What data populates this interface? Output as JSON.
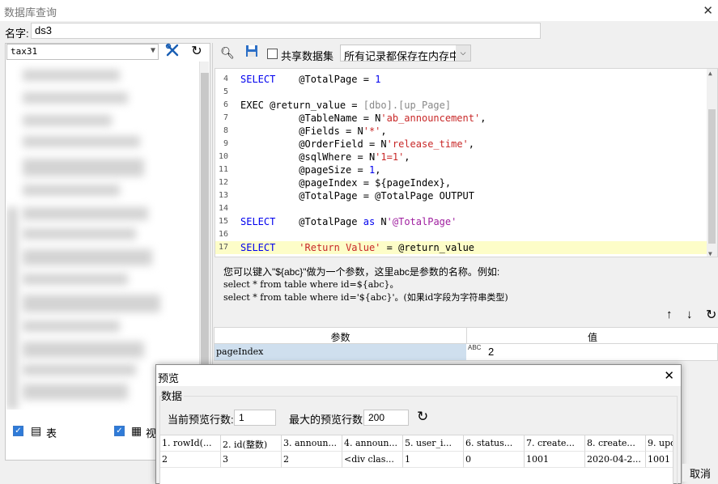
{
  "window": {
    "title": "数据库查询"
  },
  "name_field": {
    "label": "名字:",
    "value": "ds3"
  },
  "left": {
    "datasource": "tax31",
    "checkbox_table_label": "表",
    "checkbox_view_label": "视"
  },
  "toolbar": {
    "shared_dataset_label": "共享数据集",
    "storage_mode": "所有记录都保存在内存中"
  },
  "editor": {
    "lines": [
      {
        "n": "4",
        "parts": [
          [
            "kw",
            "SELECT"
          ],
          [
            "",
            "    @TotalPage = "
          ],
          [
            "kw",
            "1"
          ]
        ]
      },
      {
        "n": "5",
        "parts": []
      },
      {
        "n": "6",
        "parts": [
          [
            "",
            "EXEC @return_value = "
          ],
          [
            "gray",
            "[dbo].[up_Page]"
          ]
        ]
      },
      {
        "n": "7",
        "parts": [
          [
            "",
            "          @TableName = N"
          ],
          [
            "str",
            "'ab_announcement'"
          ],
          [
            "",
            ","
          ]
        ]
      },
      {
        "n": "8",
        "parts": [
          [
            "",
            "          @Fields = N"
          ],
          [
            "str",
            "'*'"
          ],
          [
            "",
            ","
          ]
        ]
      },
      {
        "n": "9",
        "parts": [
          [
            "",
            "          @OrderField = N"
          ],
          [
            "str",
            "'release_time'"
          ],
          [
            "",
            ","
          ]
        ]
      },
      {
        "n": "10",
        "parts": [
          [
            "",
            "          @sqlWhere = N"
          ],
          [
            "str",
            "'1=1'"
          ],
          [
            "",
            ","
          ]
        ]
      },
      {
        "n": "11",
        "parts": [
          [
            "",
            "          @pageSize = "
          ],
          [
            "kw",
            "1"
          ],
          [
            "",
            ","
          ]
        ]
      },
      {
        "n": "12",
        "parts": [
          [
            "",
            "          @pageIndex = ${pageIndex},"
          ]
        ]
      },
      {
        "n": "13",
        "parts": [
          [
            "",
            "          @TotalPage = @TotalPage OUTPUT"
          ]
        ]
      },
      {
        "n": "14",
        "parts": []
      },
      {
        "n": "15",
        "parts": [
          [
            "kw",
            "SELECT"
          ],
          [
            "",
            "    @TotalPage "
          ],
          [
            "kw",
            "as"
          ],
          [
            "",
            " N"
          ],
          [
            "purple",
            "'@TotalPage'"
          ]
        ]
      },
      {
        "n": "16",
        "parts": []
      },
      {
        "n": "17",
        "parts": [
          [
            "kw",
            "SELECT"
          ],
          [
            "",
            "    "
          ],
          [
            "str",
            "'Return Value'"
          ],
          [
            "",
            " = @return_value"
          ]
        ]
      }
    ]
  },
  "help": {
    "line1": "您可以键入\"${abc}\"做为一个参数，这里abc是参数的名称。例如:",
    "line2": "select * from table where id=${abc}。",
    "line3": "select * from table where id='${abc}'。(如果id字段为字符串类型)"
  },
  "params": {
    "col_param": "参数",
    "col_value": "值",
    "rows": [
      {
        "name": "pageIndex",
        "type": "ABC",
        "value": "2"
      }
    ]
  },
  "preview": {
    "title": "预览",
    "group": "数据",
    "current_rows_label": "当前预览行数:",
    "current_rows": "1",
    "max_rows_label": "最大的预览行数:",
    "max_rows": "200",
    "columns": [
      "1. rowId(...",
      "2. id(整数)",
      "3. announ...",
      "4. announ...",
      "5. user_i...",
      "6. status...",
      "7. create...",
      "8. create...",
      "9. upd"
    ],
    "rows": [
      [
        "2",
        "3",
        "2",
        "<div clas...",
        "1",
        "0",
        "1001",
        "2020-04-2...",
        "1001"
      ]
    ]
  },
  "cancel_label": "取消"
}
